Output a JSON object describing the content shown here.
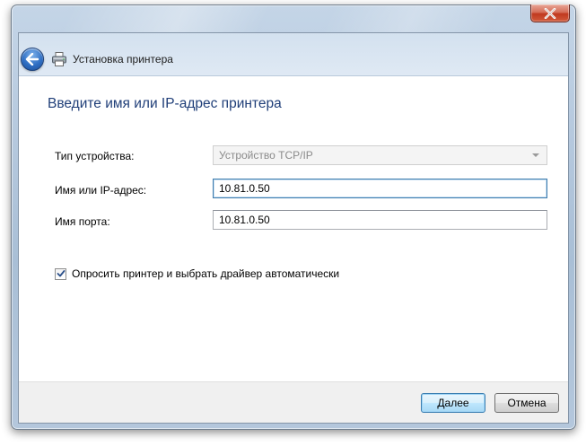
{
  "window": {
    "title": "Установка принтера"
  },
  "page": {
    "heading": "Введите имя или IP-адрес принтера"
  },
  "form": {
    "device_type": {
      "label": "Тип устройства:",
      "value": "Устройство TCP/IP"
    },
    "hostname": {
      "label": "Имя или IP-адрес:",
      "value": "10.81.0.50"
    },
    "port_name": {
      "label": "Имя порта:",
      "value": "10.81.0.50"
    },
    "query_printer": {
      "label": "Опросить принтер и выбрать драйвер автоматически",
      "checked": true
    }
  },
  "buttons": {
    "next_label": "Далее",
    "cancel_label": "Отмена"
  },
  "icons": {
    "close": "close-icon",
    "back": "back-arrow-icon",
    "printer": "printer-icon",
    "dropdown": "chevron-down-icon",
    "check": "checkmark-icon"
  },
  "colors": {
    "heading": "#1f3e78",
    "close_button": "#c0391f",
    "back_button": "#2f6fc4",
    "default_button_border": "#3c7fb1"
  }
}
